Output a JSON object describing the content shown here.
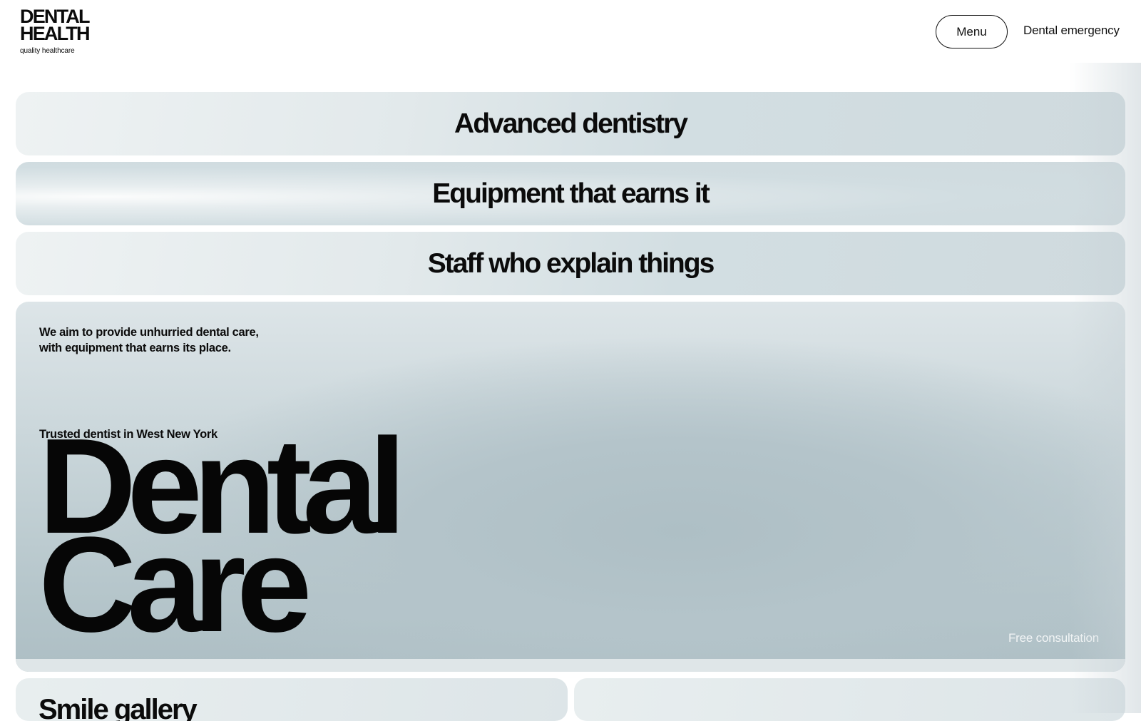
{
  "header": {
    "logo_line1": "DENTAL",
    "logo_line2": "HEALTH",
    "logo_tagline": "quality healthcare",
    "menu_label": "Menu",
    "emergency_label": "Dental emergency"
  },
  "features": [
    {
      "title": "Advanced dentistry"
    },
    {
      "title": "Equipment that earns it"
    },
    {
      "title": "Staff who explain things"
    }
  ],
  "hero": {
    "intro": "We aim to provide unhurried dental care, with equipment that earns its place.",
    "kicker": "Trusted dentist in West New York",
    "title_line1": "Dental",
    "title_line2": "Care",
    "cta": "Free consultation"
  },
  "cards": {
    "left_title": "Smile gallery",
    "right_title": ""
  },
  "colors": {
    "text": "#0b0b0b",
    "panel": "#d2dee2",
    "hero": "#b4c4ca",
    "cta_text": "#f1f4f5"
  }
}
